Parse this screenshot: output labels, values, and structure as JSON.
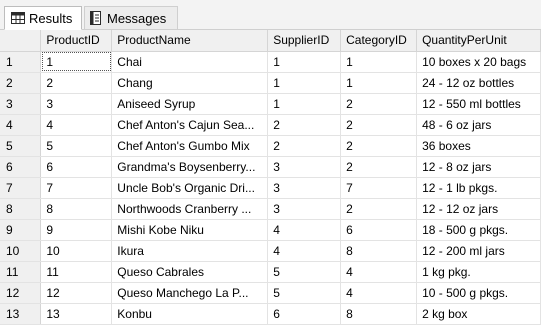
{
  "tabs": {
    "results": "Results",
    "messages": "Messages"
  },
  "grid": {
    "columns": [
      "ProductID",
      "ProductName",
      "SupplierID",
      "CategoryID",
      "QuantityPerUnit"
    ],
    "rows": [
      {
        "num": "1",
        "cells": [
          "1",
          "Chai",
          "1",
          "1",
          "10 boxes x 20 bags"
        ]
      },
      {
        "num": "2",
        "cells": [
          "2",
          "Chang",
          "1",
          "1",
          "24 - 12 oz bottles"
        ]
      },
      {
        "num": "3",
        "cells": [
          "3",
          "Aniseed Syrup",
          "1",
          "2",
          "12 - 550 ml bottles"
        ]
      },
      {
        "num": "4",
        "cells": [
          "4",
          "Chef Anton's Cajun Sea...",
          "2",
          "2",
          "48 - 6 oz jars"
        ]
      },
      {
        "num": "5",
        "cells": [
          "5",
          "Chef Anton's Gumbo Mix",
          "2",
          "2",
          "36 boxes"
        ]
      },
      {
        "num": "6",
        "cells": [
          "6",
          "Grandma's Boysenberry...",
          "3",
          "2",
          "12 - 8 oz jars"
        ]
      },
      {
        "num": "7",
        "cells": [
          "7",
          "Uncle Bob's Organic Dri...",
          "3",
          "7",
          "12 - 1 lb pkgs."
        ]
      },
      {
        "num": "8",
        "cells": [
          "8",
          "Northwoods Cranberry ...",
          "3",
          "2",
          "12 - 12 oz jars"
        ]
      },
      {
        "num": "9",
        "cells": [
          "9",
          "Mishi Kobe Niku",
          "4",
          "6",
          "18 - 500 g pkgs."
        ]
      },
      {
        "num": "10",
        "cells": [
          "10",
          "Ikura",
          "4",
          "8",
          "12 - 200 ml jars"
        ]
      },
      {
        "num": "11",
        "cells": [
          "11",
          "Queso Cabrales",
          "5",
          "4",
          "1 kg pkg."
        ]
      },
      {
        "num": "12",
        "cells": [
          "12",
          "Queso Manchego La P...",
          "5",
          "4",
          "10 - 500 g pkgs."
        ]
      },
      {
        "num": "13",
        "cells": [
          "13",
          "Konbu",
          "6",
          "8",
          "2 kg box"
        ]
      }
    ]
  }
}
